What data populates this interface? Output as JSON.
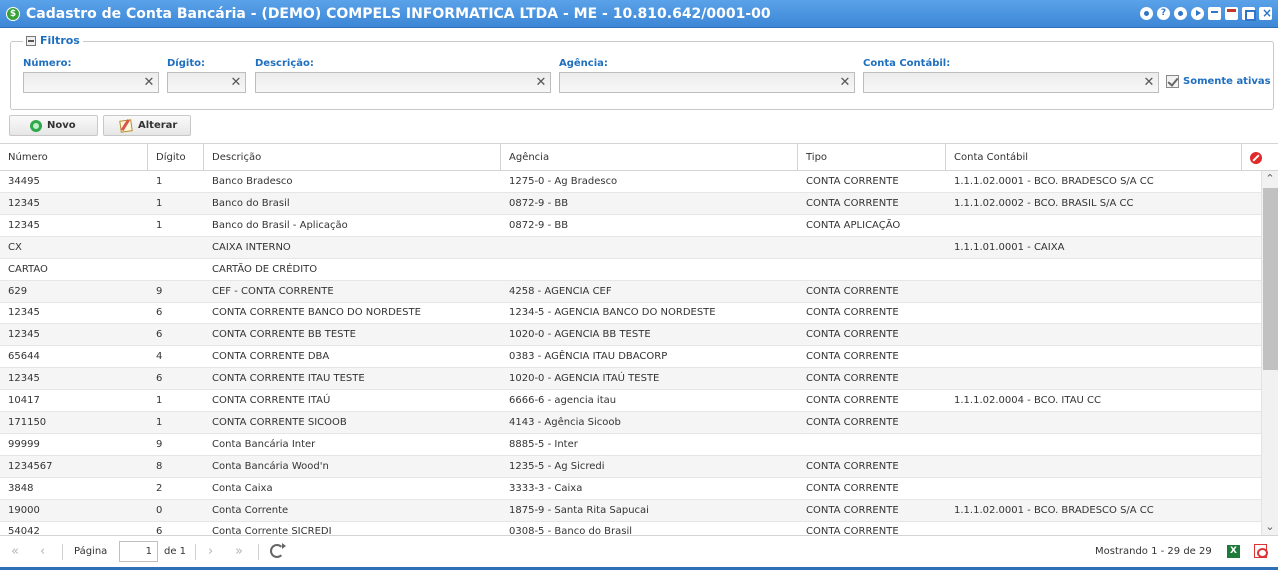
{
  "window": {
    "title": "Cadastro de Conta Bancária - (DEMO) COMPELS INFORMATICA LTDA - ME - 10.810.642/0001-00",
    "app_icon": "$",
    "tools": [
      "settings-icon",
      "help-icon",
      "info-icon",
      "play-icon",
      "download-icon",
      "calendar-icon",
      "expand-icon",
      "close-icon"
    ],
    "title_bar_color": "#3d87d6"
  },
  "filters": {
    "legend": "Filtros",
    "numero_label": "Número:",
    "digito_label": "Dígito:",
    "descricao_label": "Descrição:",
    "agencia_label": "Agência:",
    "conta_contabil_label": "Conta Contábil:",
    "numero_value": "",
    "digito_value": "",
    "descricao_value": "",
    "agencia_value": "",
    "conta_contabil_value": "",
    "clear_glyph": "✕",
    "somente_ativas_label": "Somente ativas",
    "somente_ativas_checked": true
  },
  "toolbar": {
    "novo_label": "Novo",
    "alterar_label": "Alterar"
  },
  "grid": {
    "columns": [
      "Número",
      "Dígito",
      "Descrição",
      "Agência",
      "Tipo",
      "Conta Contábil"
    ],
    "rows": [
      {
        "numero": "34495",
        "digito": "1",
        "descricao": "Banco Bradesco",
        "agencia": "1275-0 - Ag Bradesco",
        "tipo": "CONTA CORRENTE",
        "conta_contabil": "1.1.1.02.0001 - BCO. BRADESCO S/A CC"
      },
      {
        "numero": "12345",
        "digito": "1",
        "descricao": "Banco do Brasil",
        "agencia": "0872-9 - BB",
        "tipo": "CONTA CORRENTE",
        "conta_contabil": "1.1.1.02.0002 - BCO. BRASIL S/A CC"
      },
      {
        "numero": "12345",
        "digito": "1",
        "descricao": "Banco do Brasil - Aplicação",
        "agencia": "0872-9 - BB",
        "tipo": "CONTA APLICAÇÃO",
        "conta_contabil": ""
      },
      {
        "numero": "CX",
        "digito": "",
        "descricao": "CAIXA INTERNO",
        "agencia": "",
        "tipo": "",
        "conta_contabil": "1.1.1.01.0001 - CAIXA"
      },
      {
        "numero": "CARTAO",
        "digito": "",
        "descricao": "CARTÃO DE CRÉDITO",
        "agencia": "",
        "tipo": "",
        "conta_contabil": ""
      },
      {
        "numero": "629",
        "digito": "9",
        "descricao": "CEF - CONTA CORRENTE",
        "agencia": "4258 - AGENCIA CEF",
        "tipo": "CONTA CORRENTE",
        "conta_contabil": ""
      },
      {
        "numero": "12345",
        "digito": "6",
        "descricao": "CONTA CORRENTE BANCO DO NORDESTE",
        "agencia": "1234-5 - AGENCIA BANCO DO NORDESTE",
        "tipo": "CONTA CORRENTE",
        "conta_contabil": ""
      },
      {
        "numero": "12345",
        "digito": "6",
        "descricao": "CONTA CORRENTE BB TESTE",
        "agencia": "1020-0 - AGENCIA BB TESTE",
        "tipo": "CONTA CORRENTE",
        "conta_contabil": ""
      },
      {
        "numero": "65644",
        "digito": "4",
        "descricao": "CONTA CORRENTE DBA",
        "agencia": "0383 - AGÊNCIA ITAU DBACORP",
        "tipo": "CONTA CORRENTE",
        "conta_contabil": ""
      },
      {
        "numero": "12345",
        "digito": "6",
        "descricao": "CONTA CORRENTE ITAU TESTE",
        "agencia": "1020-0 - AGENCIA ITAÚ TESTE",
        "tipo": "CONTA CORRENTE",
        "conta_contabil": ""
      },
      {
        "numero": "10417",
        "digito": "1",
        "descricao": "CONTA CORRENTE ITAÚ",
        "agencia": "6666-6 - agencia itau",
        "tipo": "CONTA CORRENTE",
        "conta_contabil": "1.1.1.02.0004 - BCO. ITAU CC"
      },
      {
        "numero": "171150",
        "digito": "1",
        "descricao": "CONTA CORRENTE SICOOB",
        "agencia": "4143 - Agência Sicoob",
        "tipo": "CONTA CORRENTE",
        "conta_contabil": ""
      },
      {
        "numero": "99999",
        "digito": "9",
        "descricao": "Conta Bancária Inter",
        "agencia": "8885-5 - Inter",
        "tipo": "",
        "conta_contabil": ""
      },
      {
        "numero": "1234567",
        "digito": "8",
        "descricao": "Conta Bancária Wood'n",
        "agencia": "1235-5 - Ag Sicredi",
        "tipo": "CONTA CORRENTE",
        "conta_contabil": ""
      },
      {
        "numero": "3848",
        "digito": "2",
        "descricao": "Conta Caixa",
        "agencia": "3333-3 - Caixa",
        "tipo": "CONTA CORRENTE",
        "conta_contabil": ""
      },
      {
        "numero": "19000",
        "digito": "0",
        "descricao": "Conta Corrente",
        "agencia": "1875-9 - Santa Rita Sapucai",
        "tipo": "CONTA CORRENTE",
        "conta_contabil": "1.1.1.02.0001 - BCO. BRADESCO S/A CC"
      },
      {
        "numero": "54042",
        "digito": "6",
        "descricao": "Conta Corrente SICREDI",
        "agencia": "0308-5 - Banco do Brasil",
        "tipo": "CONTA CORRENTE",
        "conta_contabil": ""
      }
    ]
  },
  "pager": {
    "page_label": "Página",
    "page_value": "1",
    "of_label": "de 1",
    "showing": "Mostrando 1 - 29 de 29",
    "excel_glyph": "X"
  }
}
